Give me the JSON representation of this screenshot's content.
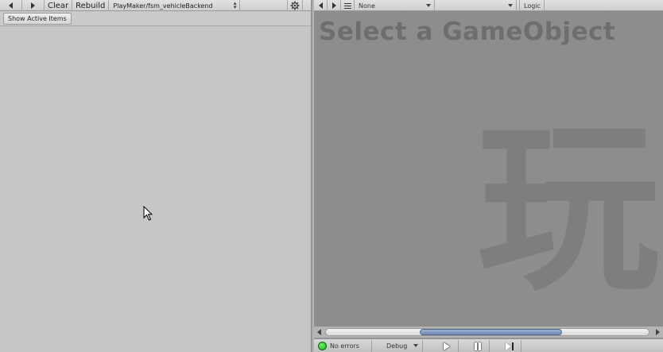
{
  "left_toolbar": {
    "clear_label": "Clear",
    "rebuild_label": "Rebuild",
    "fsm_selector_value": "PlayMaker/fsm_vehicleBackend",
    "back_icon": "triangle-left",
    "forward_icon": "triangle-right",
    "settings_icon": "gear"
  },
  "left_subbar": {
    "show_button_label": "Show Active Items"
  },
  "right_toolbar": {
    "back_icon": "triangle-left",
    "forward_icon": "triangle-right",
    "list_icon": "list",
    "object_dropdown_value": "None",
    "fsm_dropdown_value": "",
    "logic_label": "Logic"
  },
  "canvas": {
    "heading": "Select a GameObject",
    "watermark": "玩"
  },
  "scrollbar": {
    "thumb_start": 0.29,
    "thumb_size": 0.44
  },
  "status_bar": {
    "errors_label": "No errors",
    "debug_label": "Debug",
    "play_icon": "play",
    "pause_icon": "pause",
    "step_icon": "step-forward",
    "status_color": "#1db31d"
  }
}
